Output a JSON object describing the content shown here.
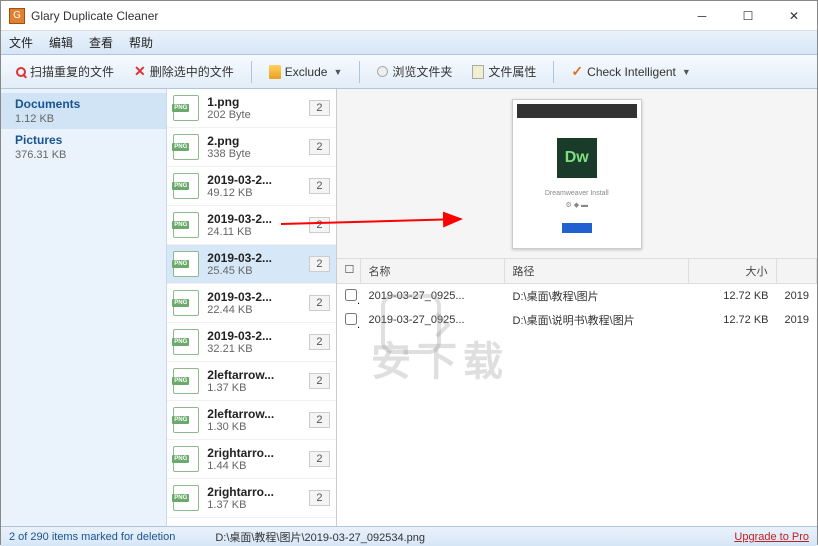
{
  "window": {
    "title": "Glary Duplicate Cleaner"
  },
  "menu": {
    "file": "文件",
    "edit": "编辑",
    "view": "查看",
    "help": "帮助"
  },
  "toolbar": {
    "scan": "扫描重复的文件",
    "delete": "删除选中的文件",
    "exclude": "Exclude",
    "browse": "浏览文件夹",
    "props": "文件属性",
    "check": "Check Intelligent"
  },
  "sidebar": {
    "items": [
      {
        "name": "Documents",
        "size": "1.12 KB",
        "selected": true
      },
      {
        "name": "Pictures",
        "size": "376.31 KB",
        "selected": false
      }
    ]
  },
  "files": [
    {
      "name": "1.png",
      "size": "202 Byte",
      "count": "2"
    },
    {
      "name": "2.png",
      "size": "338 Byte",
      "count": "2"
    },
    {
      "name": "2019-03-2...",
      "size": "49.12 KB",
      "count": "2"
    },
    {
      "name": "2019-03-2...",
      "size": "24.11 KB",
      "count": "2"
    },
    {
      "name": "2019-03-2...",
      "size": "25.45 KB",
      "count": "2",
      "selected": true
    },
    {
      "name": "2019-03-2...",
      "size": "22.44 KB",
      "count": "2"
    },
    {
      "name": "2019-03-2...",
      "size": "32.21 KB",
      "count": "2"
    },
    {
      "name": "2leftarrow...",
      "size": "1.37 KB",
      "count": "2"
    },
    {
      "name": "2leftarrow...",
      "size": "1.30 KB",
      "count": "2"
    },
    {
      "name": "2rightarro...",
      "size": "1.44 KB",
      "count": "2"
    },
    {
      "name": "2rightarro...",
      "size": "1.37 KB",
      "count": "2"
    }
  ],
  "detail": {
    "headers": {
      "name": "名称",
      "path": "路径",
      "size": "大小"
    },
    "rows": [
      {
        "name": "2019-03-27_0925...",
        "path": "D:\\桌面\\教程\\图片",
        "size": "12.72 KB",
        "date": "2019"
      },
      {
        "name": "2019-03-27_0925...",
        "path": "D:\\桌面\\说明书\\教程\\图片",
        "size": "12.72 KB",
        "date": "2019"
      }
    ]
  },
  "preview": {
    "logo": "Dw"
  },
  "status": {
    "left": "2 of 290 items marked for deletion",
    "mid": "D:\\桌面\\教程\\图片\\2019-03-27_092534.png",
    "right": "Upgrade to Pro"
  }
}
